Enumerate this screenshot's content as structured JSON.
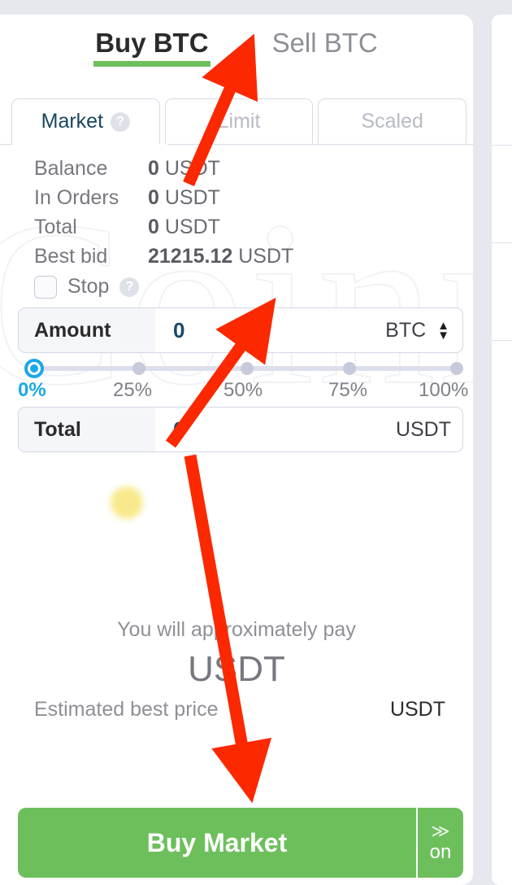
{
  "header": {
    "buy_tab": "Buy BTC",
    "sell_tab": "Sell BTC",
    "accent_green": "#6dbf5c"
  },
  "order_type_tabs": [
    {
      "label": "Market",
      "active": true,
      "has_help": true
    },
    {
      "label": "Limit",
      "active": false,
      "has_help": false
    },
    {
      "label": "Scaled",
      "active": false,
      "has_help": false
    }
  ],
  "info_rows": [
    {
      "label": "Balance",
      "value": "0",
      "currency": "USDT"
    },
    {
      "label": "In Orders",
      "value": "0",
      "currency": "USDT"
    },
    {
      "label": "Total",
      "value": "0",
      "currency": "USDT"
    },
    {
      "label": "Best bid",
      "value": "21215.12",
      "currency": "USDT"
    }
  ],
  "stop": {
    "label": "Stop",
    "checked": false,
    "help": "?"
  },
  "amount_field": {
    "label": "Amount",
    "value": "0",
    "unit": "BTC"
  },
  "total_field": {
    "label": "Total",
    "value": "0",
    "unit": "USDT"
  },
  "slider": {
    "selected": "0%",
    "ticks": [
      "0%",
      "25%",
      "50%",
      "75%",
      "100%"
    ],
    "accent_blue": "#1ba8e8"
  },
  "summary": {
    "pay_label": "You will approximately pay",
    "pay_amount": "USDT",
    "estimate_label": "Estimated best price",
    "estimate_value": "USDT"
  },
  "buy_button": {
    "label": "Buy Market",
    "toggle_chevrons": "≫",
    "toggle_state": "on"
  },
  "watermark": {
    "text": "Coinre"
  }
}
